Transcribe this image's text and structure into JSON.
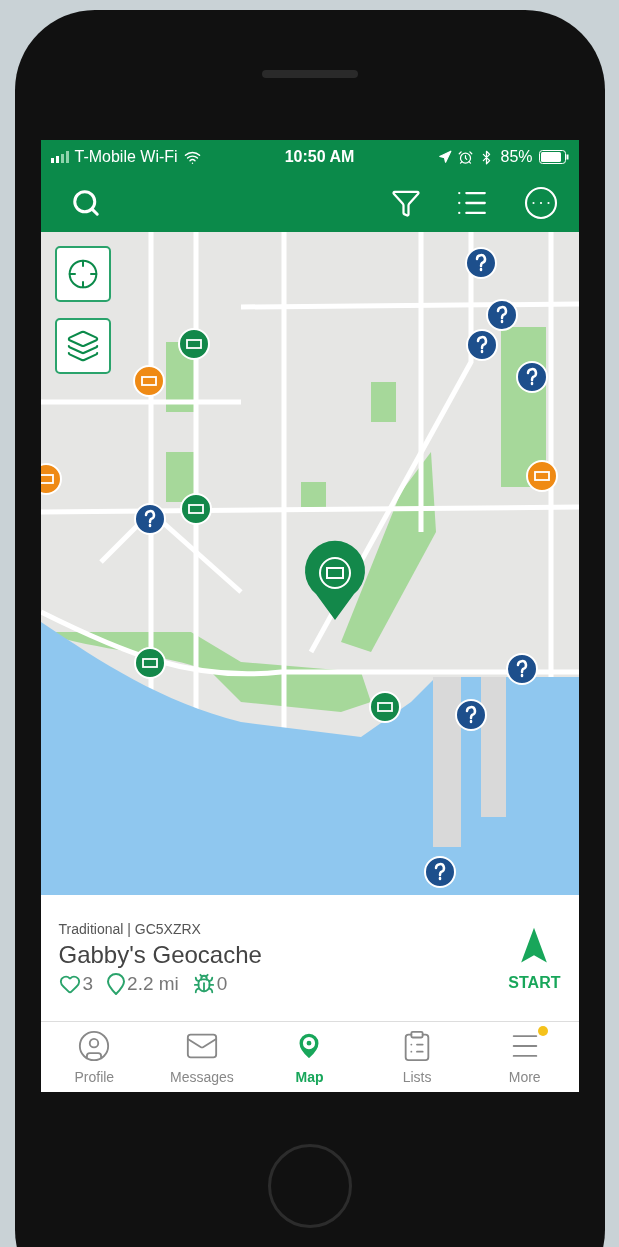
{
  "status_bar": {
    "carrier": "T-Mobile Wi-Fi",
    "time": "10:50 AM",
    "battery": "85%"
  },
  "cache_card": {
    "meta": "Traditional | GC5XZRX",
    "name": "Gabby's Geocache",
    "favorites": "3",
    "distance": "2.2 mi",
    "trackables": "0",
    "action": "START"
  },
  "tabs": [
    {
      "kind": "profile",
      "label": "Profile",
      "selected": false,
      "badge": false
    },
    {
      "kind": "messages",
      "label": "Messages",
      "selected": false,
      "badge": false
    },
    {
      "kind": "map",
      "label": "Map",
      "selected": true,
      "badge": false
    },
    {
      "kind": "lists",
      "label": "Lists",
      "selected": false,
      "badge": false
    },
    {
      "kind": "more",
      "label": "More",
      "selected": false,
      "badge": true
    }
  ]
}
